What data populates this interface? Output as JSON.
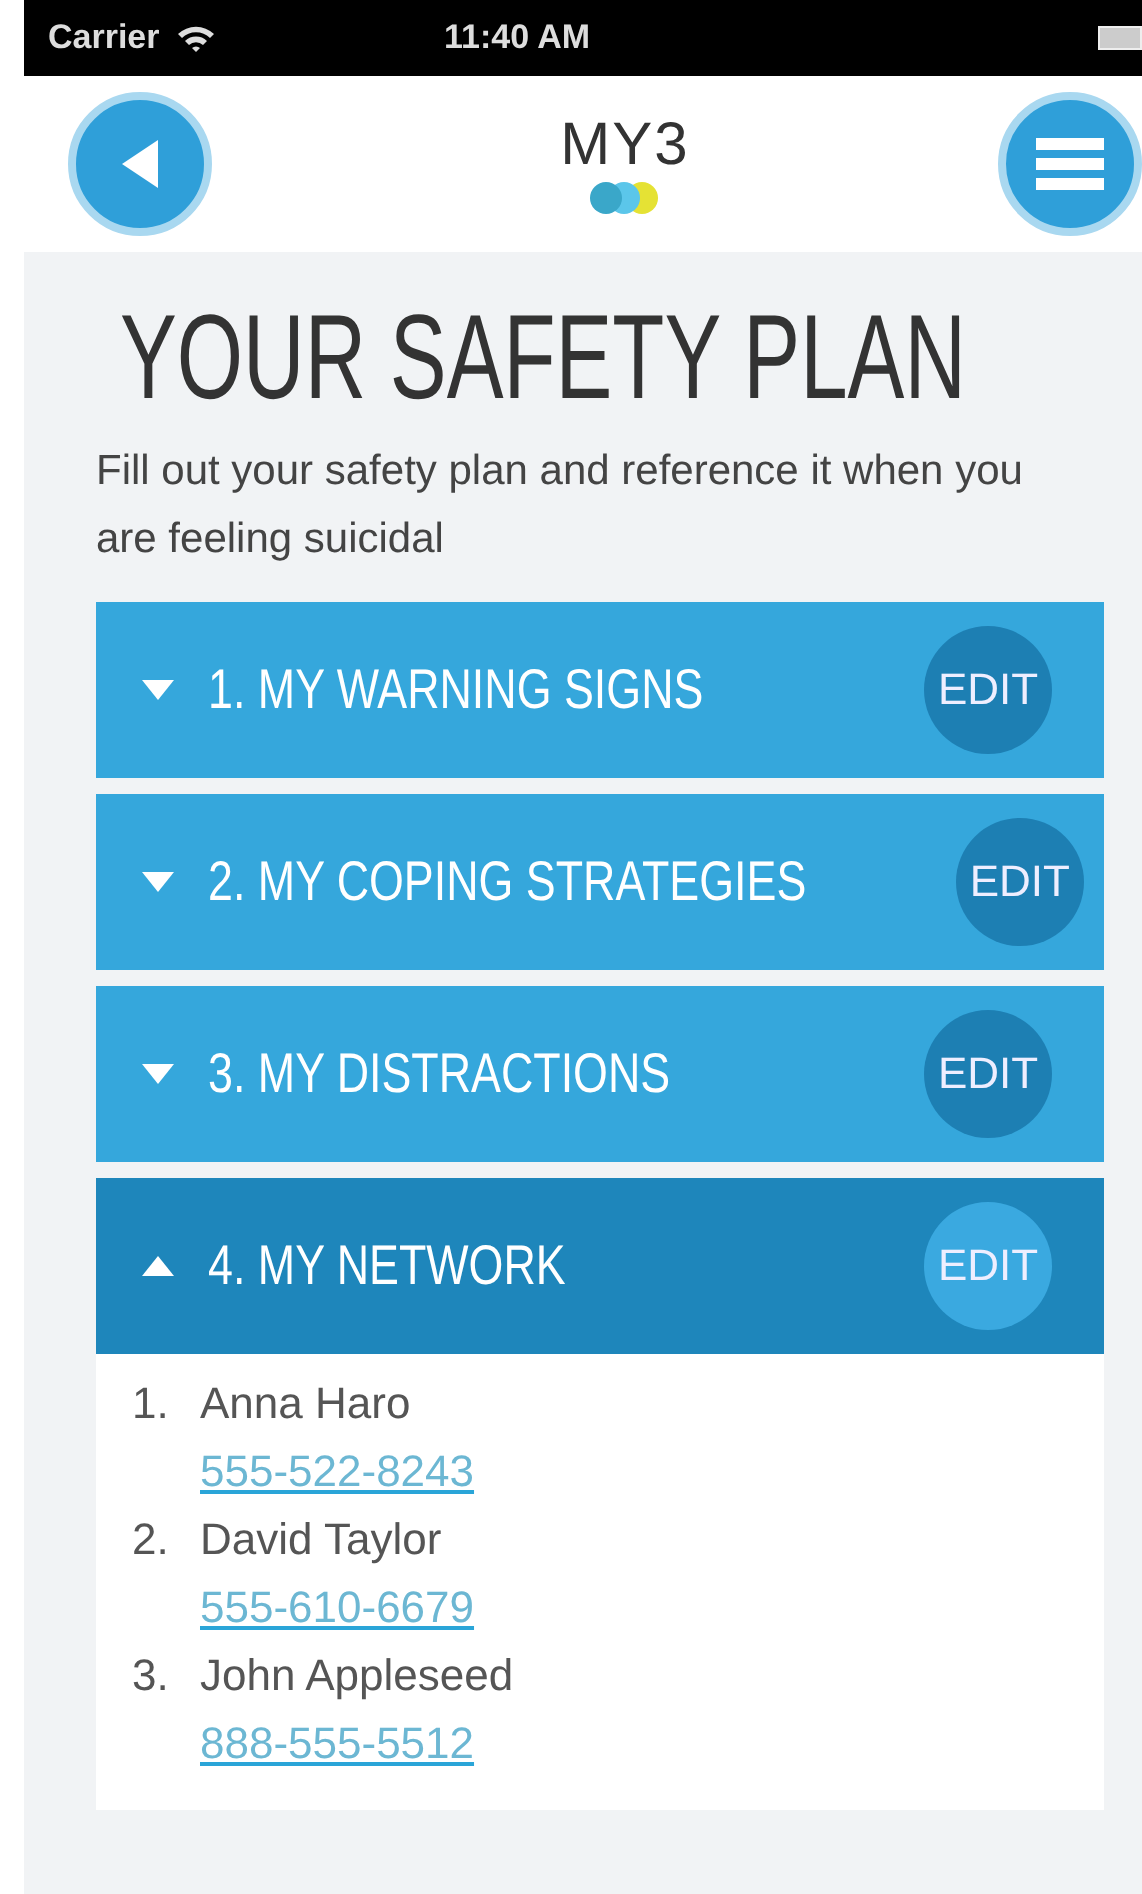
{
  "status_bar": {
    "carrier": "Carrier",
    "time": "11:40 AM"
  },
  "header": {
    "logo": "MY3"
  },
  "title": "YOUR SAFETY PLAN",
  "subtitle": "Fill out your safety plan and reference it when you are feeling suicidal",
  "sections": [
    {
      "title": "1. MY WARNING SIGNS",
      "action": "EDIT",
      "expanded": false
    },
    {
      "title": "2. MY COPING STRATEGIES",
      "action": "EDIT",
      "expanded": false
    },
    {
      "title": "3. MY DISTRACTIONS",
      "action": "EDIT",
      "expanded": false
    },
    {
      "title": "4. MY NETWORK",
      "action": "EDIT",
      "expanded": true,
      "contacts": [
        {
          "number": "1.",
          "name": "Anna Haro",
          "phone": "555-522-8243"
        },
        {
          "number": "2.",
          "name": "David Taylor",
          "phone": "555-610-6679"
        },
        {
          "number": "3.",
          "name": "John Appleseed",
          "phone": "888-555-5512"
        }
      ]
    }
  ]
}
